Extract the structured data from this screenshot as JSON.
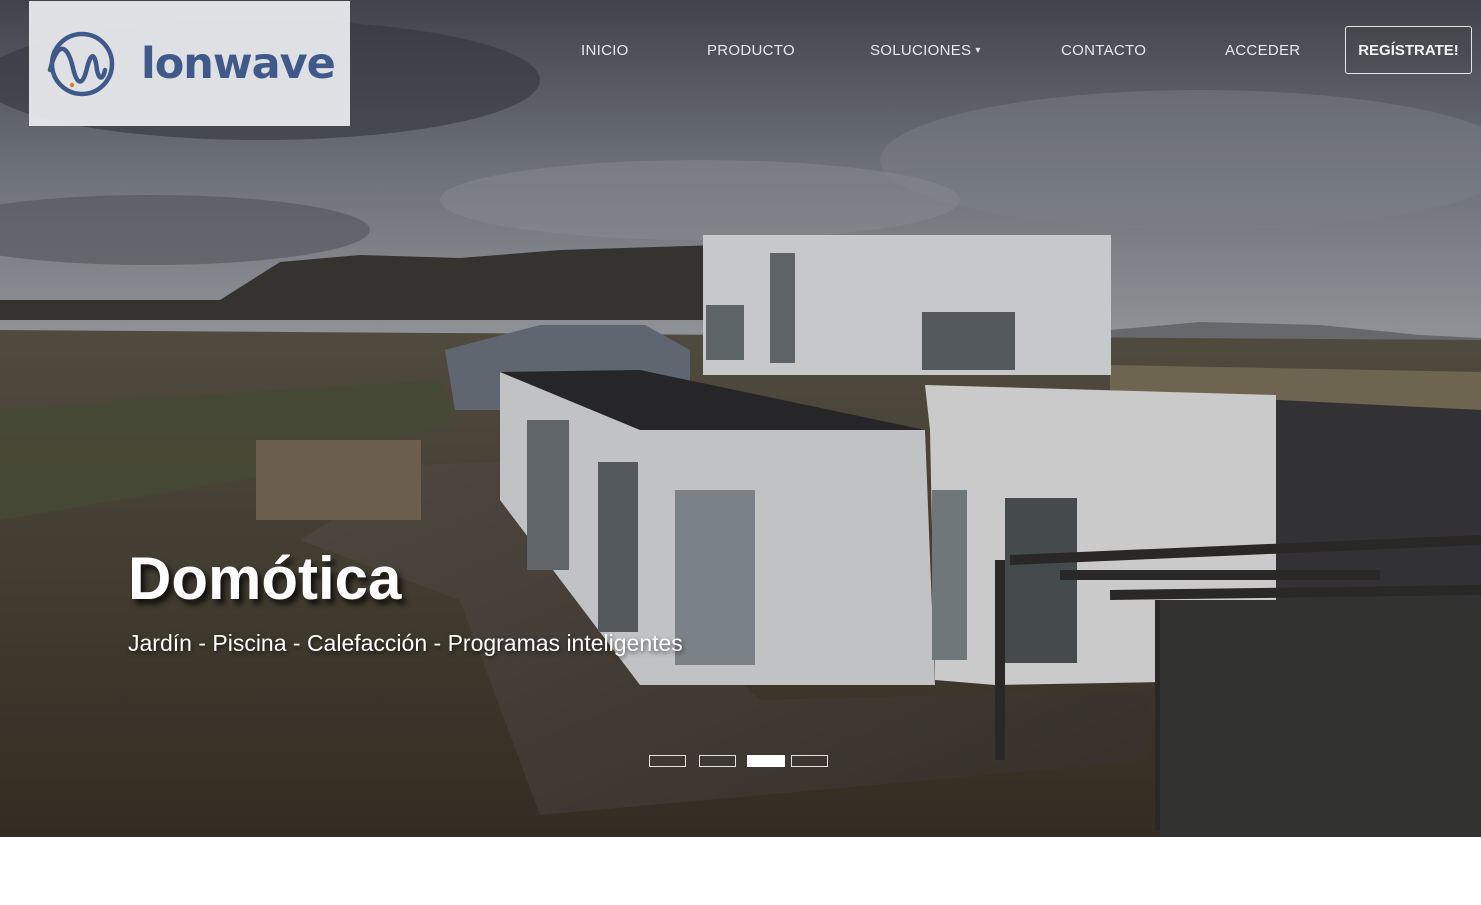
{
  "brand": {
    "name": "lonwave",
    "logo_color": "#3f5a8a",
    "icon": "wave-logo-icon"
  },
  "nav": {
    "items": [
      {
        "label": "INICIO"
      },
      {
        "label": "PRODUCTO"
      },
      {
        "label": "SOLUCIONES",
        "has_dropdown": true
      },
      {
        "label": "CONTACTO"
      },
      {
        "label": "ACCEDER"
      }
    ],
    "dropdown_icon": "▾",
    "register_label": "REGÍSTRATE!"
  },
  "hero": {
    "title": "Domótica",
    "subtitle": "Jardín - Piscina - Calefacción - Programas inteligentes",
    "slides": 4,
    "active_slide": 3
  }
}
